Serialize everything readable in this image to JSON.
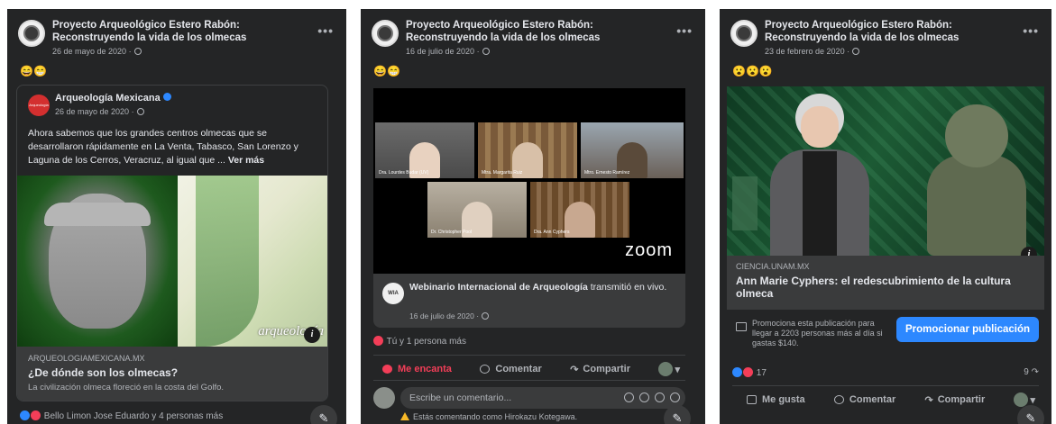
{
  "colors": {
    "panel_bg": "#242526",
    "card_bg": "#3a3b3c",
    "text": "#e4e6eb",
    "muted": "#b0b3b8",
    "accent": "#2d88ff",
    "love": "#f33e58"
  },
  "page_name": "Proyecto Arqueológico Estero Rabón: Reconstruyendo la vida de los olmecas",
  "post1": {
    "date": "26 de mayo de 2020 ·",
    "emoji": "😄😁",
    "shared_author": "Arqueología Mexicana",
    "shared_avatar_text": "Arqueología",
    "shared_date": "26 de mayo de 2020 ·",
    "text": "Ahora sabemos que los grandes centros olmecas que se desarrollaron rápidamente en La Venta, Tabasco, San Lorenzo y Laguna de los Cerros, Veracruz, al igual que ...",
    "see_more": "Ver más",
    "image_caption": "arqueología",
    "link_source": "ARQUEOLOGIAMEXICANA.MX",
    "link_title": "¿De dónde son los olmecas?",
    "link_subtitle": "La civilización olmeca floreció en la costa del Golfo.",
    "reactions_text": "Bello Limon Jose Eduardo y 4 personas más"
  },
  "post2": {
    "date": "16 de julio de 2020 ·",
    "emoji": "😄😁",
    "video_brand": "zoom",
    "participants": [
      "Dra. Lourdes Budar (UV)",
      "Mtra. Margarita Ruiz",
      "Mtro. Ernesto Ramírez",
      "Dr. Christopher Pool",
      "Dra. Ann Cyphers"
    ],
    "host_badge": "WIA",
    "host_name": "Webinario Internacional de Arqueología",
    "live_text": "transmitió en vivo.",
    "live_date": "16 de julio de 2020 ·",
    "reactions_text": "Tú y 1 persona más",
    "action_love": "Me encanta",
    "action_comment": "Comentar",
    "action_share": "Compartir",
    "comment_placeholder": "Escribe un comentario...",
    "commenting_as": "Estás comentando como Hirokazu Kotegawa."
  },
  "post3": {
    "date": "23 de febrero de 2020 ·",
    "emoji": "😮😮😮",
    "link_source": "CIENCIA.UNAM.MX",
    "link_title": "Ann Marie Cyphers: el redescubrimiento de la cultura olmeca",
    "promo_text": "Promociona esta publicación para llegar a 2203 personas más al día si gastas $140.",
    "promo_button": "Promocionar publicación",
    "reaction_count": "17",
    "share_count": "9",
    "action_like": "Me gusta",
    "action_comment": "Comentar",
    "action_share": "Compartir"
  },
  "icons": {
    "more": "more-dots-icon",
    "globe": "globe-icon",
    "info": "info-icon",
    "edit": "compose-icon"
  },
  "glyphs": {
    "more": "•••",
    "info": "i",
    "edit": "✎",
    "share_arrow": "↷",
    "dropdown": "▾"
  }
}
